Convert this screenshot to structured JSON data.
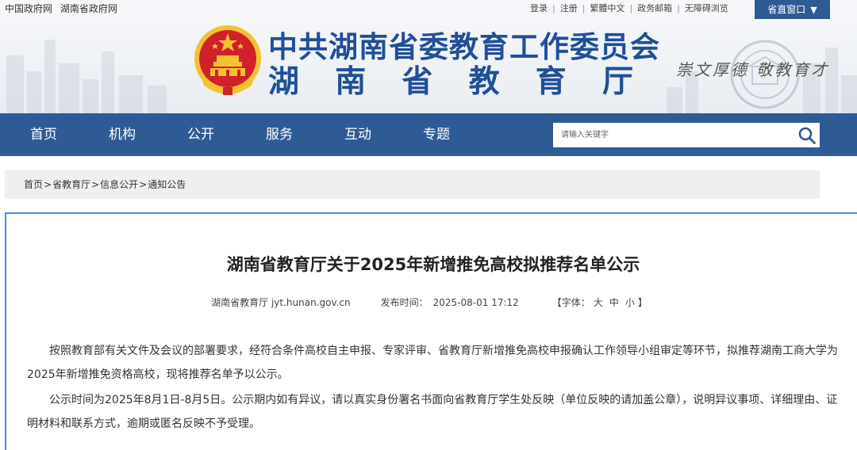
{
  "top_bar": {
    "left_links": [
      "中国政府网",
      "湖南省政府网"
    ],
    "right_links": [
      "登录",
      "注册",
      "繁體中文",
      "政务邮箱",
      "无障碍浏览"
    ],
    "dept_button": "省直窗口"
  },
  "header": {
    "title": "中共湖南省委教育工作委员会",
    "subtitle_chars": [
      "湖",
      "南",
      "省",
      "教",
      "育",
      "厅"
    ],
    "slogan": "崇文厚德  敬教育才"
  },
  "nav": {
    "items": [
      "首页",
      "机构",
      "公开",
      "服务",
      "互动",
      "专题"
    ]
  },
  "search": {
    "placeholder": "请输入关键字"
  },
  "breadcrumb": [
    "首页",
    "省教育厅",
    "信息公开",
    "通知公告"
  ],
  "article": {
    "title": "湖南省教育厅关于2025年新增推免高校拟推荐名单公示",
    "source": "湖南省教育厅 jyt.hunan.gov.cn",
    "publish_label": "发布时间：",
    "publish_time": "2025-08-01 17:12",
    "font_label": "【字体：",
    "font_sizes": [
      "大",
      "中",
      "小"
    ],
    "font_close": "】",
    "paragraphs": [
      "按照教育部有关文件及会议的部署要求，经符合条件高校自主申报、专家评审、省教育厅新增推免高校申报确认工作领导小组审定等环节，拟推荐湖南工商大学为2025年新增推免资格高校，现将推荐名单予以公示。",
      "公示时间为2025年8月1日-8月5日。公示期内如有异议，请以真实身份署名书面向省教育厅学生处反映（单位反映的请加盖公章），说明异议事项、详细理由、证明材料和联系方式，逾期或匿名反映不予受理。"
    ]
  },
  "colors": {
    "nav_bg": "#2f5b95",
    "title_blue": "#1f4f97",
    "content_border": "#4a8fd6",
    "emblem_red": "#d0202a",
    "emblem_gold": "#f2c231"
  }
}
